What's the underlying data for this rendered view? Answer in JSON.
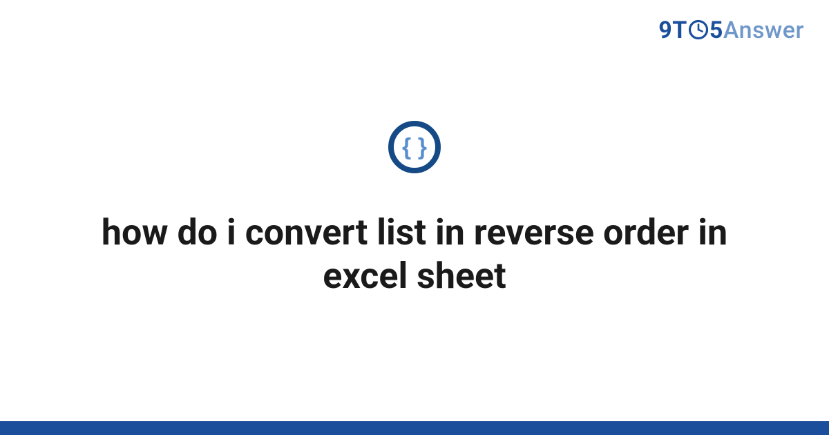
{
  "brand": {
    "part1": "9T",
    "part2": "5",
    "part3": "Answer"
  },
  "badge": {
    "icon": "code-braces-icon"
  },
  "main": {
    "title": "how do i convert list in reverse order in excel sheet"
  },
  "colors": {
    "brand_primary": "#1b4f9c",
    "brand_secondary": "#6f97c9",
    "badge_ring": "#154a86",
    "badge_brace": "#5a8fce"
  }
}
